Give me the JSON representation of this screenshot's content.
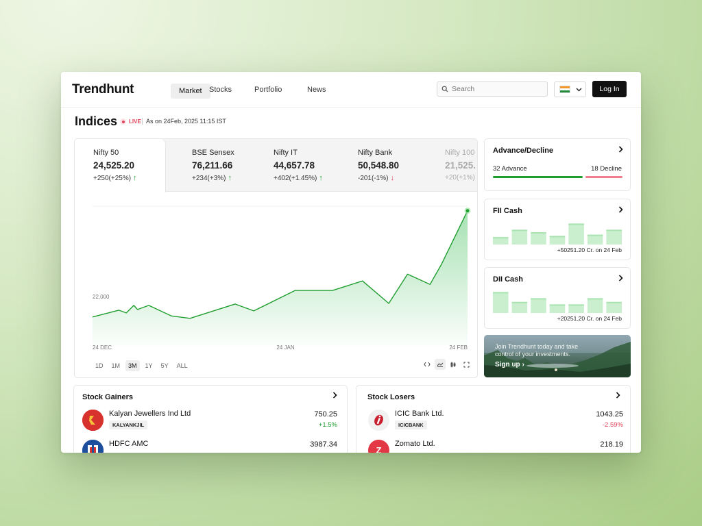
{
  "app": {
    "brand": "Trendhunt"
  },
  "nav": {
    "tabs": [
      {
        "label": "Market"
      },
      {
        "label": "Stocks"
      },
      {
        "label": "Portfolio"
      },
      {
        "label": "News"
      }
    ]
  },
  "search": {
    "placeholder": "Search"
  },
  "country": {
    "flag": "india-flag-icon"
  },
  "auth": {
    "login_label": "Log In"
  },
  "page": {
    "title": "Indices",
    "live_label": "LIVE",
    "as_of": "As on 24Feb, 2025 11:15 IST"
  },
  "indices": [
    {
      "name": "Nifty 50",
      "value": "24,525.20",
      "change": "+250(+25%)",
      "direction": "up"
    },
    {
      "name": "BSE Sensex",
      "value": "76,211.66",
      "change": "+234(+3%)",
      "direction": "up"
    },
    {
      "name": "Nifty IT",
      "value": "44,657.78",
      "change": "+402(+1.45%)",
      "direction": "up"
    },
    {
      "name": "Nifty Bank",
      "value": "50,548.80",
      "change": "-201(-1%)",
      "direction": "down"
    },
    {
      "name": "Nifty 100",
      "value": "21,525.",
      "change": "+20(+1%)",
      "direction": "up"
    }
  ],
  "chart_data": {
    "type": "area",
    "series_name": "Nifty 50",
    "y_tick_label": "22,000",
    "y_tick_value": 22000,
    "x_tick_labels": [
      "24 DEC",
      "24 JAN",
      "24 FEB"
    ],
    "ylim": [
      20550,
      24700
    ],
    "x": [
      0,
      7,
      9,
      11,
      12,
      15,
      21,
      26,
      38,
      43,
      54,
      64,
      72,
      79,
      84,
      90,
      93,
      100
    ],
    "values": [
      21400,
      21600,
      21520,
      21740,
      21620,
      21740,
      21430,
      21360,
      21780,
      21580,
      22180,
      22180,
      22460,
      21800,
      22660,
      22360,
      22940,
      24525
    ],
    "grid": true,
    "line_color": "#1f9d2e"
  },
  "ranges": {
    "options": [
      "1D",
      "1M",
      "3M",
      "1Y",
      "5Y",
      "ALL"
    ],
    "selected": "3M"
  },
  "chart_tools": [
    "code-icon",
    "area-chart-icon",
    "candlestick-icon",
    "fullscreen-icon"
  ],
  "advance_decline": {
    "title": "Advance/Decline",
    "advance_label": "32 Advance",
    "decline_label": "18 Decline",
    "advance": 32,
    "decline": 18
  },
  "fii_cash": {
    "title": "FII Cash",
    "note": "+50251.20 Cr. on 24 Feb",
    "bars": [
      0.3,
      0.6,
      0.5,
      0.35,
      0.85,
      0.4,
      0.6
    ]
  },
  "dii_cash": {
    "title": "DII Cash",
    "note": "+20251.20 Cr. on 24 Feb",
    "bars": [
      0.85,
      0.45,
      0.6,
      0.35,
      0.35,
      0.6,
      0.45
    ]
  },
  "promo": {
    "text": "Join Trendhunt today and take control of your investments.",
    "link": "Sign up"
  },
  "gainers": {
    "title": "Stock Gainers",
    "rows": [
      {
        "name": "Kalyan Jewellers Ind Ltd",
        "ticker": "KALYANKJIL",
        "price": "750.25",
        "change": "+1.5%",
        "logo_letter": "K",
        "logo_color": "#d8322f"
      },
      {
        "name": "HDFC AMC",
        "ticker": "",
        "price": "3987.34",
        "change": "",
        "logo_letter": "",
        "logo_color": "#1d4f9c"
      }
    ]
  },
  "losers": {
    "title": "Stock Losers",
    "rows": [
      {
        "name": "ICIC Bank Ltd.",
        "ticker": "ICICBANK",
        "price": "1043.25",
        "change": "-2.59%",
        "logo_letter": "i",
        "logo_color": "#f3f3f3"
      },
      {
        "name": "Zomato Ltd.",
        "ticker": "",
        "price": "218.19",
        "change": "",
        "logo_letter": "Z",
        "logo_color": "#e23744"
      }
    ]
  }
}
